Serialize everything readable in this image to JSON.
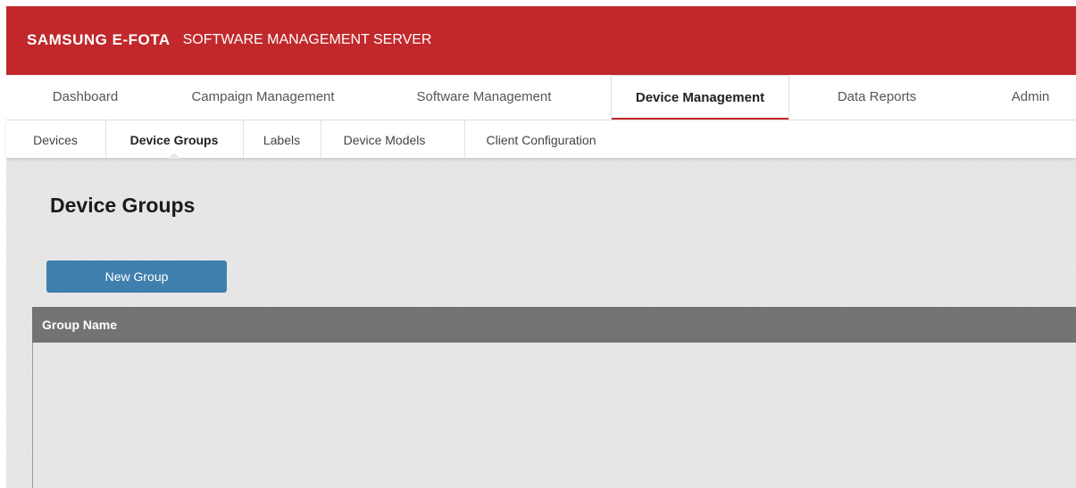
{
  "header": {
    "brand": "SAMSUNG E-FOTA",
    "subtitle": "SOFTWARE MANAGEMENT SERVER"
  },
  "main_nav": {
    "tabs": [
      {
        "label": "Dashboard"
      },
      {
        "label": "Campaign Management"
      },
      {
        "label": "Software Management"
      },
      {
        "label": "Device Management"
      },
      {
        "label": "Data Reports"
      },
      {
        "label": "Admin"
      }
    ],
    "active": "Device Management"
  },
  "sub_nav": {
    "tabs": [
      {
        "label": "Devices"
      },
      {
        "label": "Device Groups"
      },
      {
        "label": "Labels"
      },
      {
        "label": "Device Models"
      },
      {
        "label": "Client Configuration"
      }
    ],
    "active": "Device Groups"
  },
  "page": {
    "title": "Device Groups",
    "new_group_label": "New Group"
  },
  "table": {
    "columns": [
      "Group Name"
    ],
    "rows": []
  },
  "colors": {
    "brand_red": "#c0282b",
    "button_blue": "#3f7fad",
    "table_header": "#737373",
    "content_bg": "#e7e7e7"
  }
}
